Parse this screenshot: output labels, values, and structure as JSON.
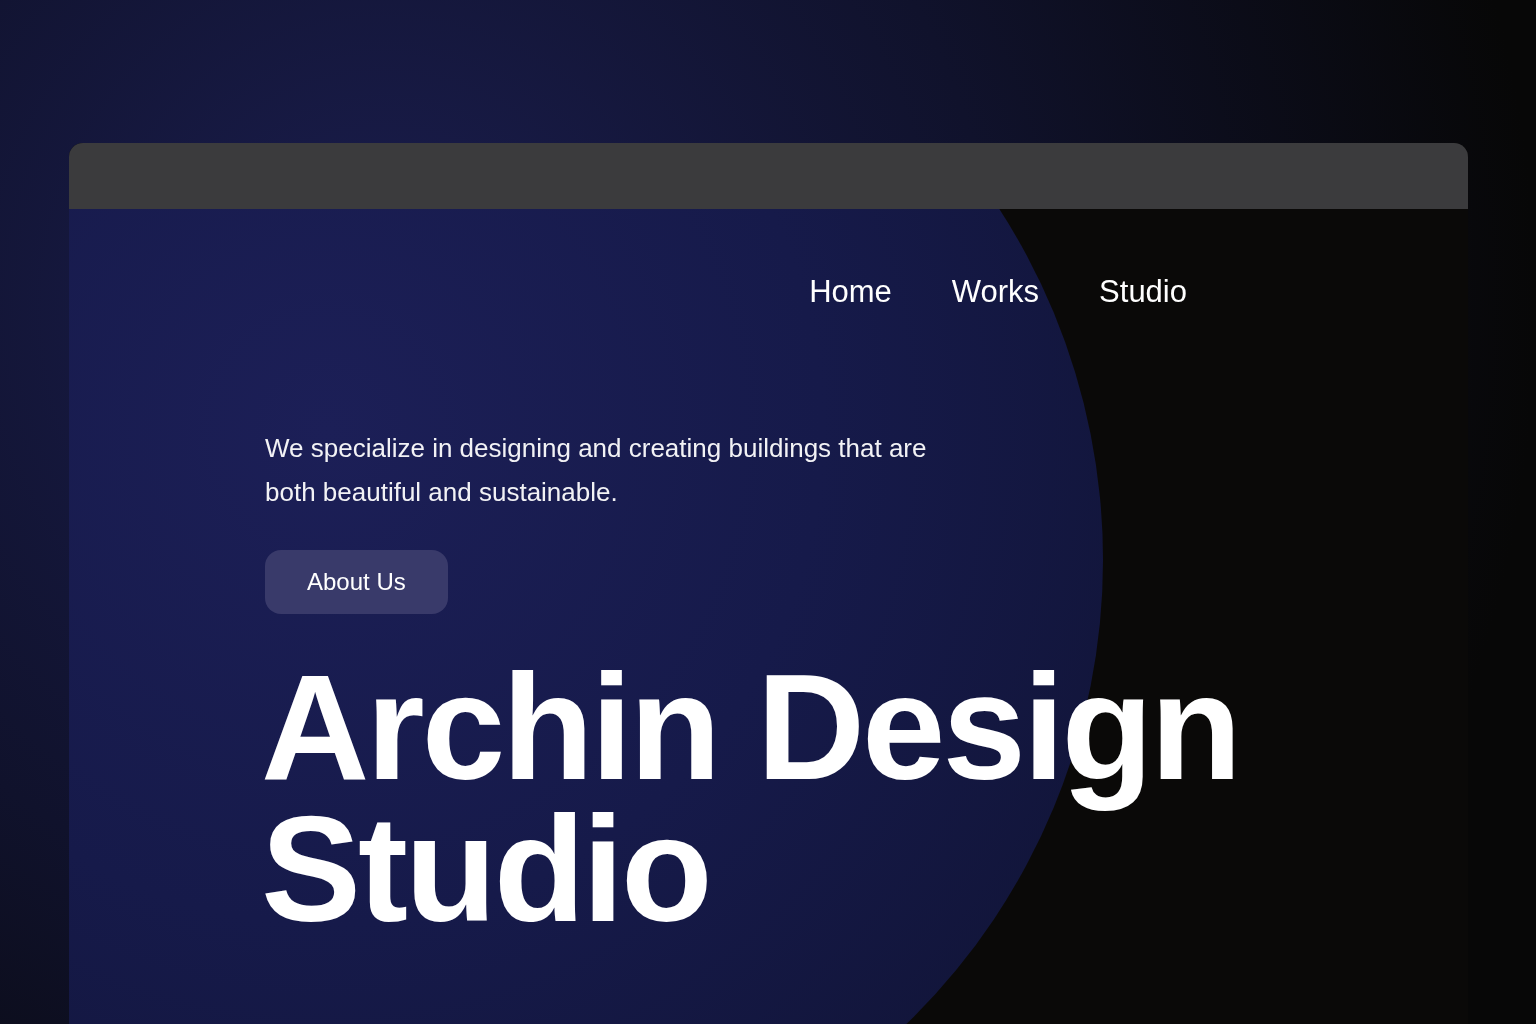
{
  "nav": [
    {
      "label": "Home"
    },
    {
      "label": "Works"
    },
    {
      "label": "Studio"
    }
  ],
  "hero": {
    "tagline": "We specialize in designing and creating buildings that are both beautiful and sustainable.",
    "button": "About Us",
    "heading": "Archin Design Studio"
  }
}
